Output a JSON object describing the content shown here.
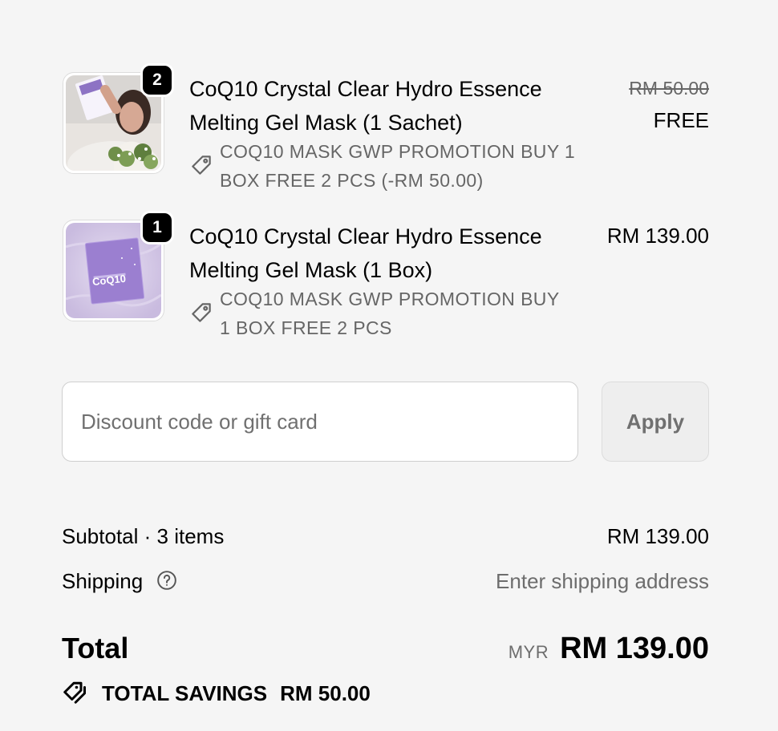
{
  "items": [
    {
      "quantity": "2",
      "title": "CoQ10 Crystal Clear Hydro Essence Melting Gel Mask (1 Sachet)",
      "discount": "COQ10 MASK GWP PROMOTION BUY 1 BOX FREE 2 PCS (-RM 50.00)",
      "original_price": "RM 50.00",
      "price": "FREE",
      "image": "woman-holding-sachet-mask-photo"
    },
    {
      "quantity": "1",
      "title": "CoQ10 Crystal Clear Hydro Essence Melting Gel Mask (1 Box)",
      "discount": "COQ10 MASK GWP PROMOTION BUY 1 BOX FREE 2 PCS",
      "price": "RM 139.00",
      "image": "purple-mask-box-photo",
      "box_label": "CoQ10"
    }
  ],
  "discount_code": {
    "placeholder": "Discount code or gift card",
    "apply_label": "Apply"
  },
  "summary": {
    "subtotal_label": "Subtotal · 3 items",
    "subtotal_value": "RM 139.00",
    "shipping_label": "Shipping",
    "shipping_value": "Enter shipping address",
    "total_label": "Total",
    "currency": "MYR",
    "total_value": "RM 139.00",
    "savings_label": "TOTAL SAVINGS",
    "savings_value": "RM 50.00"
  },
  "colors": {
    "background": "#f5f5f5",
    "badge": "#000000",
    "muted_text": "#6d6d6d",
    "product_purple": "#9b7fd0"
  }
}
